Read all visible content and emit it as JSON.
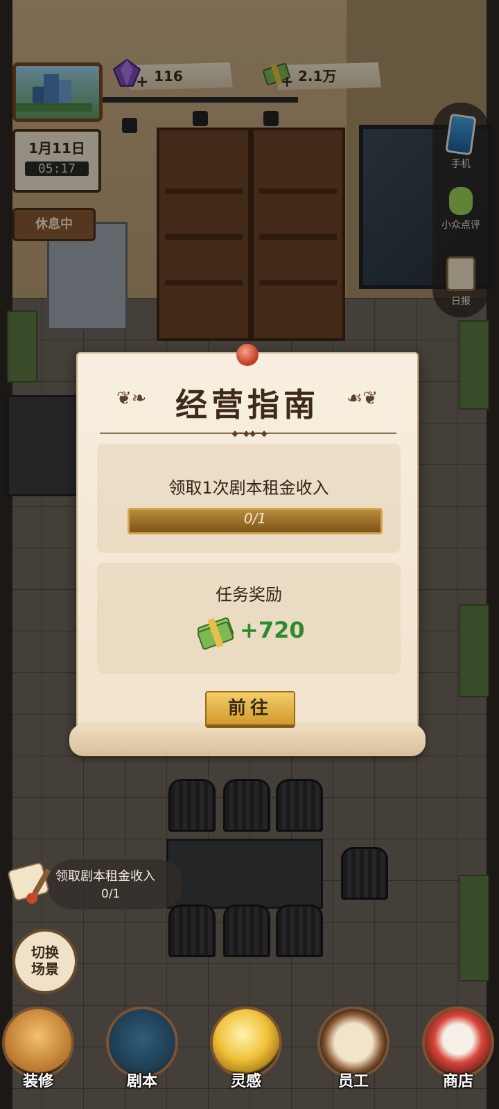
{
  "hud": {
    "gems": "116",
    "cash": "2.1万",
    "plus": "+",
    "calendar_date": "1月11日",
    "calendar_time": "05:17",
    "status_sign": "休息中"
  },
  "side_menu": [
    {
      "label": "手机",
      "icon": "phone-icon"
    },
    {
      "label": "小众点评",
      "icon": "thumbs-up-icon"
    },
    {
      "label": "日报",
      "icon": "clipboard-icon"
    }
  ],
  "modal": {
    "title": "经营指南",
    "task": "领取1次剧本租金收入",
    "progress_text": "0/1",
    "progress_fraction": 0,
    "reward_title": "任务奖励",
    "reward_value": "+720",
    "go_button": "前往"
  },
  "task_tracker": {
    "text": "领取剧本租金收入",
    "progress": "0/1"
  },
  "switch_scene": {
    "line1": "切换",
    "line2": "场景"
  },
  "bottom_nav": [
    {
      "label": "装修",
      "icon": "house-icon"
    },
    {
      "label": "剧本",
      "icon": "script-book-icon"
    },
    {
      "label": "灵感",
      "icon": "lightbulb-icon"
    },
    {
      "label": "员工",
      "icon": "id-badge-icon"
    },
    {
      "label": "商店",
      "icon": "shop-icon"
    }
  ],
  "colors": {
    "accent_gold": "#e8b653",
    "reward_green": "#2f8a2f",
    "parchment": "#f8efe0"
  }
}
